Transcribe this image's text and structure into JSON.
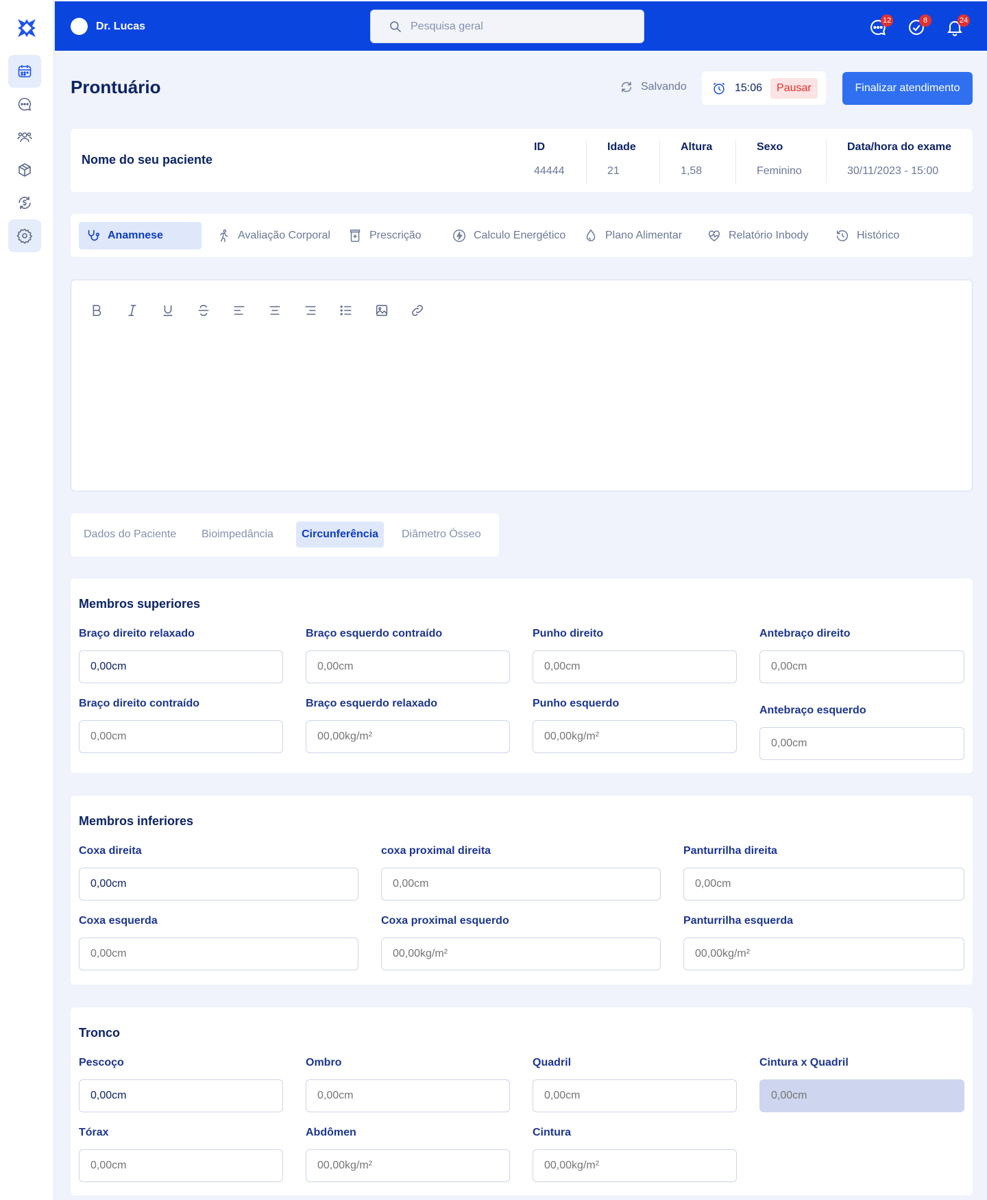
{
  "topbar": {
    "user_name": "Dr. Lucas",
    "search_placeholder": "Pesquisa geral",
    "messages_badge": "12",
    "tasks_badge": "8",
    "notifications_badge": "24",
    "brand_color": "#0b45e0"
  },
  "sidebar": {
    "icons": [
      "calendar-icon",
      "chat-icon",
      "users-icon",
      "box-icon",
      "exchange-icon",
      "gear-icon"
    ]
  },
  "header": {
    "title": "Prontuário",
    "saving_label": "Salvando",
    "timer": "15:06",
    "pause_label": "Pausar",
    "finish_label": "Finalizar atendimento"
  },
  "patient": {
    "name_placeholder": "Nome do seu paciente",
    "columns": [
      {
        "label": "ID",
        "value": "44444"
      },
      {
        "label": "Idade",
        "value": "21"
      },
      {
        "label": "Altura",
        "value": "1,58"
      },
      {
        "label": "Sexo",
        "value": "Feminino"
      },
      {
        "label": "Data/hora do exame",
        "value": "30/11/2023 - 15:00"
      }
    ]
  },
  "tabs": [
    {
      "label": "Anamnese",
      "icon": "stethoscope-icon"
    },
    {
      "label": "Avaliação Corporal",
      "icon": "running-icon"
    },
    {
      "label": "Prescrição",
      "icon": "medicine-icon"
    },
    {
      "label": "Calculo Energético",
      "icon": "bolt-icon"
    },
    {
      "label": "Plano Alimentar",
      "icon": "drop-icon"
    },
    {
      "label": "Relatório Inbody",
      "icon": "heart-pulse-icon"
    },
    {
      "label": "Histórico",
      "icon": "history-icon"
    }
  ],
  "editor": {
    "tools": [
      "bold-icon",
      "italic-icon",
      "underline-icon",
      "strikethrough-icon",
      "align-left-icon",
      "align-center-icon",
      "align-right-icon",
      "list-icon",
      "image-icon",
      "link-icon"
    ]
  },
  "subtabs": [
    "Dados do Paciente",
    "Bioimpedância",
    "Circunferência",
    "Diâmetro Ósseo"
  ],
  "sections": {
    "upper": {
      "title": "Membros superiores",
      "fields": [
        {
          "label": "Braço direito relaxado",
          "value": "0,00cm"
        },
        {
          "label": "Braço esquerdo contraído",
          "placeholder": "0,00cm"
        },
        {
          "label": "Punho direito",
          "placeholder": "0,00cm"
        },
        {
          "label": "Antebraço direito",
          "placeholder": "0,00cm"
        },
        {
          "label": "Braço direito contraído",
          "placeholder": "0,00cm"
        },
        {
          "label": "Braço esquerdo relaxado",
          "placeholder": "00,00kg/m²"
        },
        {
          "label": "Punho  esquerdo",
          "placeholder": "00,00kg/m²"
        },
        {
          "label": "Antebraço esquerdo",
          "placeholder": "0,00cm"
        }
      ]
    },
    "lower": {
      "title": "Membros inferiores",
      "fields": [
        {
          "label": "Coxa direita",
          "value": "0,00cm"
        },
        {
          "label": "coxa proximal direita",
          "placeholder": "0,00cm"
        },
        {
          "label": "Panturrilha direita",
          "placeholder": "0,00cm"
        },
        {
          "label": "Coxa esquerda",
          "placeholder": "0,00cm"
        },
        {
          "label": "Coxa proximal esquerdo",
          "placeholder": "00,00kg/m²"
        },
        {
          "label": "Panturrilha esquerda",
          "placeholder": "00,00kg/m²"
        }
      ]
    },
    "trunk": {
      "title": "Tronco",
      "fields": [
        {
          "label": "Pescoço",
          "value": "0,00cm"
        },
        {
          "label": "Ombro",
          "placeholder": "0,00cm"
        },
        {
          "label": "Quadril",
          "placeholder": "0,00cm"
        },
        {
          "label": "Cintura x  Quadril",
          "placeholder": "0,00cm",
          "disabled": true
        },
        {
          "label": "Tórax",
          "placeholder": "0,00cm"
        },
        {
          "label": "Abdômen",
          "placeholder": "00,00kg/m²"
        },
        {
          "label": "Cintura",
          "placeholder": "00,00kg/m²"
        }
      ]
    }
  }
}
